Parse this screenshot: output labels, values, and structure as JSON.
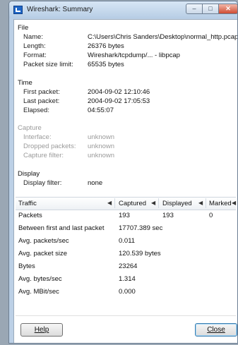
{
  "window": {
    "title": "Wireshark: Summary",
    "controls": {
      "minimize": "–",
      "maximize": "□",
      "close": "✕"
    }
  },
  "file": {
    "header": "File",
    "rows": [
      {
        "label": "Name:",
        "value": "C:\\Users\\Chris Sanders\\Desktop\\normal_http.pcap"
      },
      {
        "label": "Length:",
        "value": "26376 bytes"
      },
      {
        "label": "Format:",
        "value": "Wireshark/tcpdump/... - libpcap"
      },
      {
        "label": "Packet size limit:",
        "value": "65535 bytes"
      }
    ]
  },
  "time": {
    "header": "Time",
    "rows": [
      {
        "label": "First packet:",
        "value": "2004-09-02 12:10:46"
      },
      {
        "label": "Last packet:",
        "value": "2004-09-02 17:05:53"
      },
      {
        "label": "Elapsed:",
        "value": "04:55:07"
      }
    ]
  },
  "capture": {
    "header": "Capture",
    "rows": [
      {
        "label": "Interface:",
        "value": "unknown"
      },
      {
        "label": "Dropped packets:",
        "value": "unknown"
      },
      {
        "label": "Capture filter:",
        "value": "unknown"
      }
    ]
  },
  "display": {
    "header": "Display",
    "rows": [
      {
        "label": "Display filter:",
        "value": "none"
      }
    ]
  },
  "traffic_table": {
    "columns": [
      "Traffic",
      "Captured",
      "Displayed",
      "Marked"
    ],
    "rows": [
      [
        "Packets",
        "193",
        "193",
        "0"
      ],
      [
        "Between first and last packet",
        "17707.389 sec",
        "",
        ""
      ],
      [
        "Avg. packets/sec",
        "0.011",
        "",
        ""
      ],
      [
        "Avg. packet size",
        "120.539 bytes",
        "",
        ""
      ],
      [
        "Bytes",
        "23264",
        "",
        ""
      ],
      [
        "Avg. bytes/sec",
        "1.314",
        "",
        ""
      ],
      [
        "Avg. MBit/sec",
        "0.000",
        "",
        ""
      ]
    ]
  },
  "buttons": {
    "help": "Help",
    "close": "Close"
  }
}
